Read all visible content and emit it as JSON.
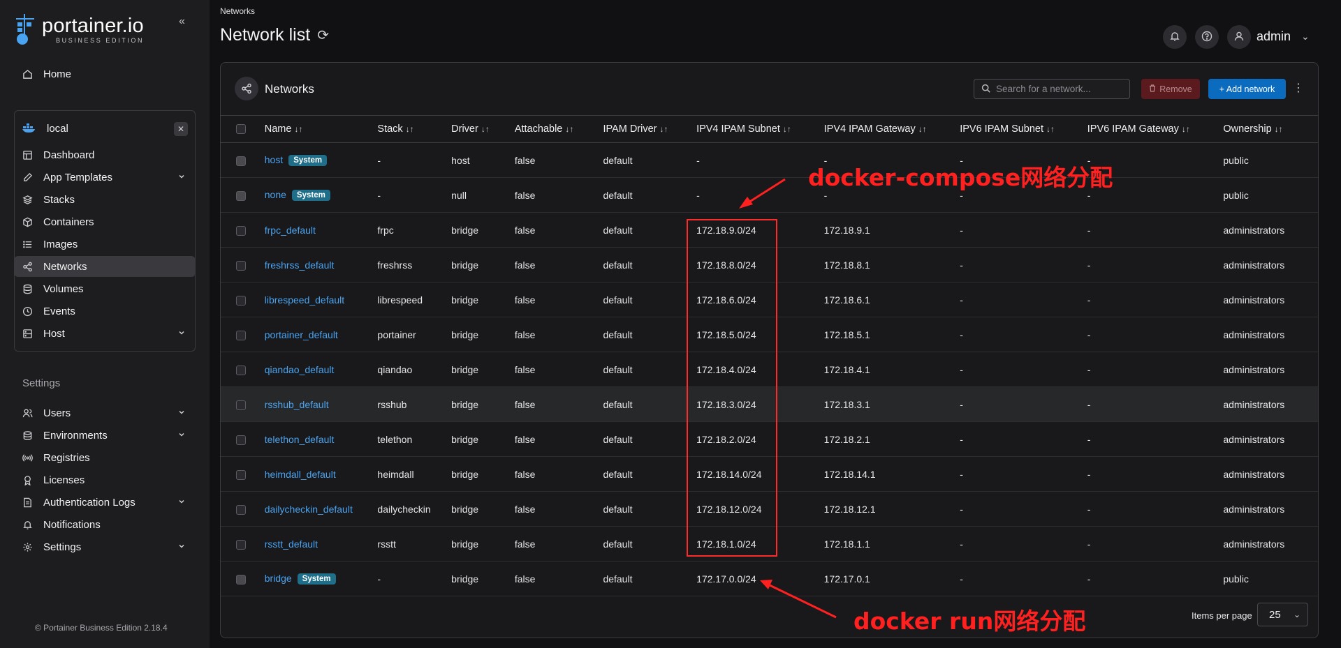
{
  "app": {
    "logo_main": "portainer.io",
    "logo_sub": "BUSINESS EDITION"
  },
  "sidebar": {
    "home": "Home",
    "environment": {
      "name": "local"
    },
    "env_items": [
      {
        "label": "Dashboard",
        "icon": "dashboard-icon"
      },
      {
        "label": "App Templates",
        "icon": "edit-icon",
        "expandable": true
      },
      {
        "label": "Stacks",
        "icon": "layers-icon"
      },
      {
        "label": "Containers",
        "icon": "box-icon"
      },
      {
        "label": "Images",
        "icon": "list-icon"
      },
      {
        "label": "Networks",
        "icon": "share-icon",
        "active": true
      },
      {
        "label": "Volumes",
        "icon": "database-icon"
      },
      {
        "label": "Events",
        "icon": "clock-icon"
      },
      {
        "label": "Host",
        "icon": "server-icon",
        "expandable": true
      }
    ],
    "settings_title": "Settings",
    "settings_items": [
      {
        "label": "Users",
        "icon": "user-icon",
        "expandable": true
      },
      {
        "label": "Environments",
        "icon": "environments-icon",
        "expandable": true
      },
      {
        "label": "Registries",
        "icon": "radio-icon"
      },
      {
        "label": "Licenses",
        "icon": "award-icon"
      },
      {
        "label": "Authentication Logs",
        "icon": "file-icon",
        "expandable": true
      },
      {
        "label": "Notifications",
        "icon": "bell-icon"
      },
      {
        "label": "Settings",
        "icon": "gear-icon",
        "expandable": true
      }
    ],
    "footer": "© Portainer Business Edition 2.18.4"
  },
  "header": {
    "breadcrumb": "Networks",
    "title": "Network list",
    "user": "admin"
  },
  "panel": {
    "title": "Networks",
    "search_placeholder": "Search for a network...",
    "remove_label": "Remove",
    "add_label": "+ Add network",
    "columns": [
      "Name",
      "Stack",
      "Driver",
      "Attachable",
      "IPAM Driver",
      "IPV4 IPAM Subnet",
      "IPV4 IPAM Gateway",
      "IPV6 IPAM Subnet",
      "IPV6 IPAM Gateway",
      "Ownership"
    ],
    "rows": [
      {
        "name": "host",
        "badge": "System",
        "stack": "-",
        "driver": "host",
        "attachable": "false",
        "ipam": "default",
        "subnet4": "-",
        "gateway4": "-",
        "subnet6": "-",
        "gateway6": "-",
        "ownership": "public",
        "system": true
      },
      {
        "name": "none",
        "badge": "System",
        "stack": "-",
        "driver": "null",
        "attachable": "false",
        "ipam": "default",
        "subnet4": "-",
        "gateway4": "-",
        "subnet6": "-",
        "gateway6": "-",
        "ownership": "public",
        "system": true
      },
      {
        "name": "frpc_default",
        "badge": "",
        "stack": "frpc",
        "driver": "bridge",
        "attachable": "false",
        "ipam": "default",
        "subnet4": "172.18.9.0/24",
        "gateway4": "172.18.9.1",
        "subnet6": "-",
        "gateway6": "-",
        "ownership": "administrators"
      },
      {
        "name": "freshrss_default",
        "badge": "",
        "stack": "freshrss",
        "driver": "bridge",
        "attachable": "false",
        "ipam": "default",
        "subnet4": "172.18.8.0/24",
        "gateway4": "172.18.8.1",
        "subnet6": "-",
        "gateway6": "-",
        "ownership": "administrators"
      },
      {
        "name": "librespeed_default",
        "badge": "",
        "stack": "librespeed",
        "driver": "bridge",
        "attachable": "false",
        "ipam": "default",
        "subnet4": "172.18.6.0/24",
        "gateway4": "172.18.6.1",
        "subnet6": "-",
        "gateway6": "-",
        "ownership": "administrators"
      },
      {
        "name": "portainer_default",
        "badge": "",
        "stack": "portainer",
        "driver": "bridge",
        "attachable": "false",
        "ipam": "default",
        "subnet4": "172.18.5.0/24",
        "gateway4": "172.18.5.1",
        "subnet6": "-",
        "gateway6": "-",
        "ownership": "administrators"
      },
      {
        "name": "qiandao_default",
        "badge": "",
        "stack": "qiandao",
        "driver": "bridge",
        "attachable": "false",
        "ipam": "default",
        "subnet4": "172.18.4.0/24",
        "gateway4": "172.18.4.1",
        "subnet6": "-",
        "gateway6": "-",
        "ownership": "administrators"
      },
      {
        "name": "rsshub_default",
        "badge": "",
        "stack": "rsshub",
        "driver": "bridge",
        "attachable": "false",
        "ipam": "default",
        "subnet4": "172.18.3.0/24",
        "gateway4": "172.18.3.1",
        "subnet6": "-",
        "gateway6": "-",
        "ownership": "administrators",
        "highlight": true
      },
      {
        "name": "telethon_default",
        "badge": "",
        "stack": "telethon",
        "driver": "bridge",
        "attachable": "false",
        "ipam": "default",
        "subnet4": "172.18.2.0/24",
        "gateway4": "172.18.2.1",
        "subnet6": "-",
        "gateway6": "-",
        "ownership": "administrators"
      },
      {
        "name": "heimdall_default",
        "badge": "",
        "stack": "heimdall",
        "driver": "bridge",
        "attachable": "false",
        "ipam": "default",
        "subnet4": "172.18.14.0/24",
        "gateway4": "172.18.14.1",
        "subnet6": "-",
        "gateway6": "-",
        "ownership": "administrators"
      },
      {
        "name": "dailycheckin_default",
        "badge": "",
        "stack": "dailycheckin",
        "driver": "bridge",
        "attachable": "false",
        "ipam": "default",
        "subnet4": "172.18.12.0/24",
        "gateway4": "172.18.12.1",
        "subnet6": "-",
        "gateway6": "-",
        "ownership": "administrators"
      },
      {
        "name": "rsstt_default",
        "badge": "",
        "stack": "rsstt",
        "driver": "bridge",
        "attachable": "false",
        "ipam": "default",
        "subnet4": "172.18.1.0/24",
        "gateway4": "172.18.1.1",
        "subnet6": "-",
        "gateway6": "-",
        "ownership": "administrators"
      },
      {
        "name": "bridge",
        "badge": "System",
        "stack": "-",
        "driver": "bridge",
        "attachable": "false",
        "ipam": "default",
        "subnet4": "172.17.0.0/24",
        "gateway4": "172.17.0.1",
        "subnet6": "-",
        "gateway6": "-",
        "ownership": "public",
        "system": true
      }
    ],
    "items_per_page_label": "Items per page",
    "items_per_page": "25"
  },
  "annotations": {
    "compose_label": "docker-compose网络分配",
    "run_label": "docker run网络分配",
    "color": "#ff2020"
  }
}
